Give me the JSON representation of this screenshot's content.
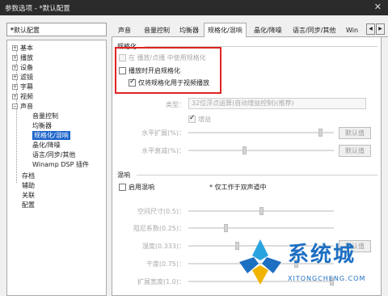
{
  "window": {
    "title": "参数选项 - *默认配置",
    "close_glyph": "✕"
  },
  "profile_select": {
    "value": "*默认配置",
    "arrow": "▾"
  },
  "tree": {
    "items": [
      {
        "label": "基本",
        "expander": "+"
      },
      {
        "label": "播放",
        "expander": "+"
      },
      {
        "label": "设备",
        "expander": "+"
      },
      {
        "label": "滤镜",
        "expander": "+"
      },
      {
        "label": "字幕",
        "expander": "+"
      },
      {
        "label": "视频",
        "expander": "+"
      },
      {
        "label": "声音",
        "expander": "−"
      },
      {
        "label": "音量控制"
      },
      {
        "label": "均衡器"
      },
      {
        "label": "规格化/混响"
      },
      {
        "label": "晶化/降噪"
      },
      {
        "label": "语言/同步/其他"
      },
      {
        "label": "Winamp DSP 插件"
      },
      {
        "label": "存档"
      },
      {
        "label": "辅助"
      },
      {
        "label": "关联"
      },
      {
        "label": "配置"
      }
    ]
  },
  "tabs": [
    {
      "label": "声音"
    },
    {
      "label": "音量控制"
    },
    {
      "label": "均衡器"
    },
    {
      "label": "规格化/混响"
    },
    {
      "label": "晶化/降噪"
    },
    {
      "label": "语言/同步/其他"
    },
    {
      "label": "Win"
    }
  ],
  "tab_scroll": {
    "left": "◀",
    "right": "▶"
  },
  "normalize": {
    "title": "规格化",
    "cb_prev": "在 播放/点播 中使用规格化",
    "cb_enable": "播放时开启规格化",
    "cb_video_only": "仅将规格化用于视频播放",
    "type_label": "类型：",
    "type_value": "32位浮点运算(自动增益控制)(推荐)",
    "gain_label": "增益",
    "level_label": "水平扩展(%)：",
    "decay_label": "水平衰减(%)：",
    "default_btn": "默认值"
  },
  "normalize_sliders": {
    "level": 0.92,
    "decay": 0.38
  },
  "reverb": {
    "title": "混响",
    "cb_enable": "启用混响",
    "note": "* 仅工作于双声道中",
    "room_label": "空间尺寸(0.5)：",
    "damp_label": "阻尼系数(0.25)：",
    "wet_label": "湿度(0.333)：",
    "dry_label": "干度(0.75)：",
    "width_label": "扩展宽度(1.0)：",
    "default_btn": "默认值"
  },
  "reverb_sliders": {
    "room": 0.5,
    "damp": 0.25,
    "wet": 0.33,
    "dry": 0.75,
    "width": 1.0
  },
  "watermark": {
    "text": "系统城",
    "sub": "XITONGCHENG.COM"
  },
  "colors": {
    "highlight": "#e02323",
    "selection": "#1a63c9",
    "watermark": "#1d6fc2"
  }
}
